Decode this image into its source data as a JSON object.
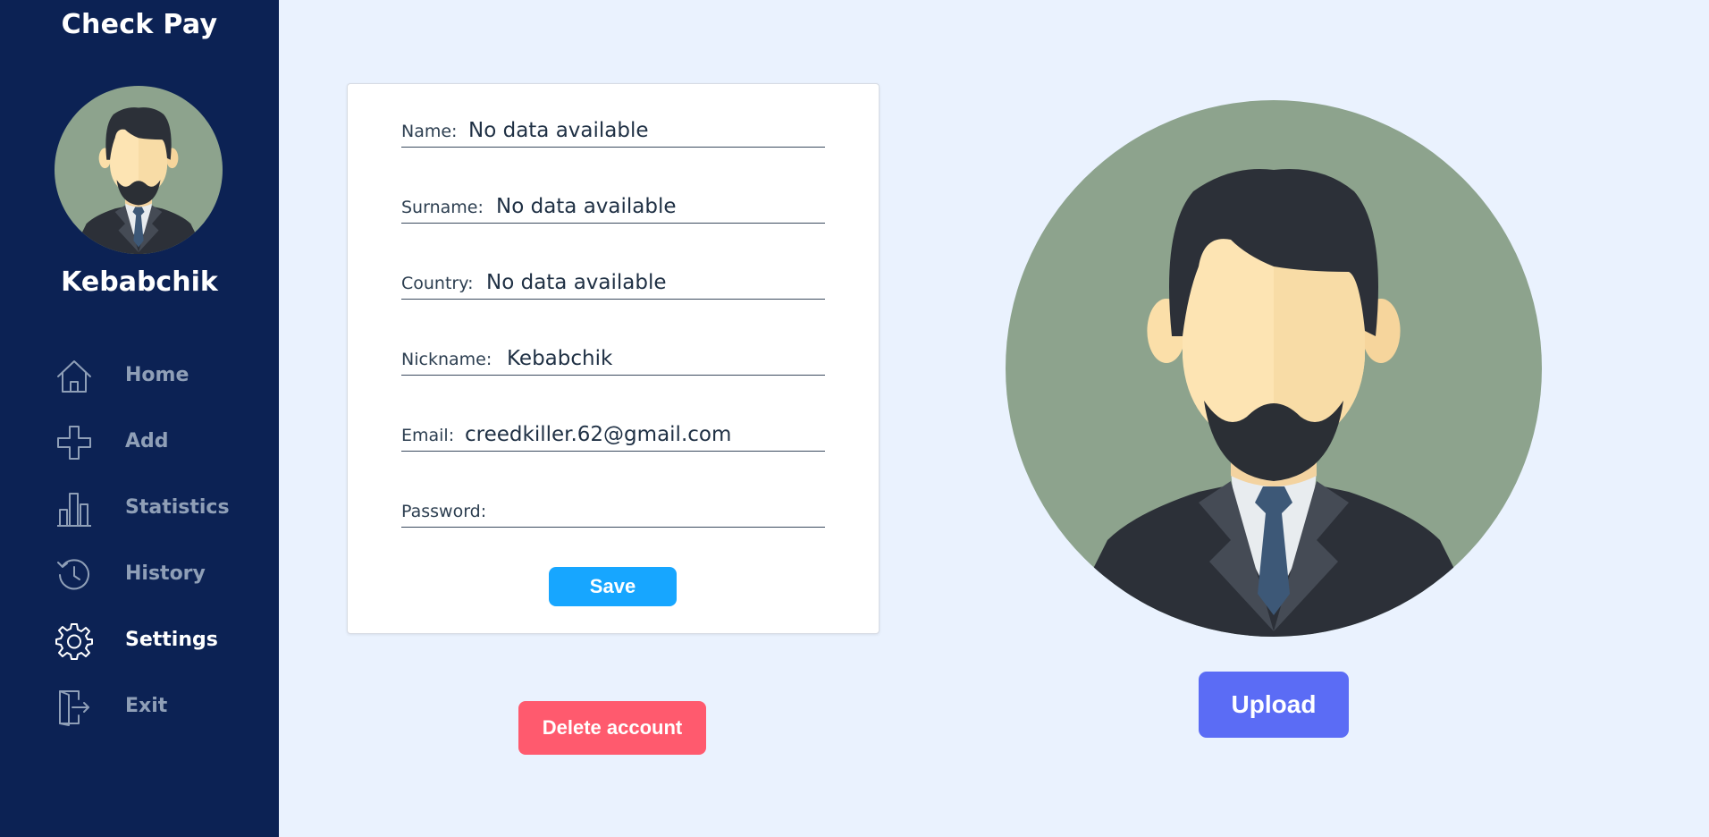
{
  "app": {
    "title": "Check Pay"
  },
  "sidebar": {
    "username": "Kebabchik",
    "avatar_icon": "man-avatar-icon",
    "items": [
      {
        "label": "Home",
        "icon": "home-icon",
        "active": false
      },
      {
        "label": "Add",
        "icon": "plus-icon",
        "active": false
      },
      {
        "label": "Statistics",
        "icon": "bar-chart-icon",
        "active": false
      },
      {
        "label": "History",
        "icon": "history-icon",
        "active": false
      },
      {
        "label": "Settings",
        "icon": "gear-icon",
        "active": true
      },
      {
        "label": "Exit",
        "icon": "exit-icon",
        "active": false
      }
    ]
  },
  "form": {
    "fields": [
      {
        "label": "Name:",
        "value": "No data available"
      },
      {
        "label": "Surname:",
        "value": "No data available"
      },
      {
        "label": "Country:",
        "value": "No data available"
      },
      {
        "label": "Nickname:",
        "value": "Kebabchik"
      },
      {
        "label": "Email:",
        "value": "creedkiller.62@gmail.com"
      },
      {
        "label": "Password:",
        "value": ""
      }
    ],
    "save_label": "Save"
  },
  "actions": {
    "delete_label": "Delete account",
    "upload_label": "Upload"
  },
  "colors": {
    "sidebar_bg": "#0c2254",
    "page_bg": "#eaf2fe",
    "save": "#17a6ff",
    "delete": "#ff5a6e",
    "upload": "#5b6cf5",
    "avatar_bg": "#8da38d"
  }
}
